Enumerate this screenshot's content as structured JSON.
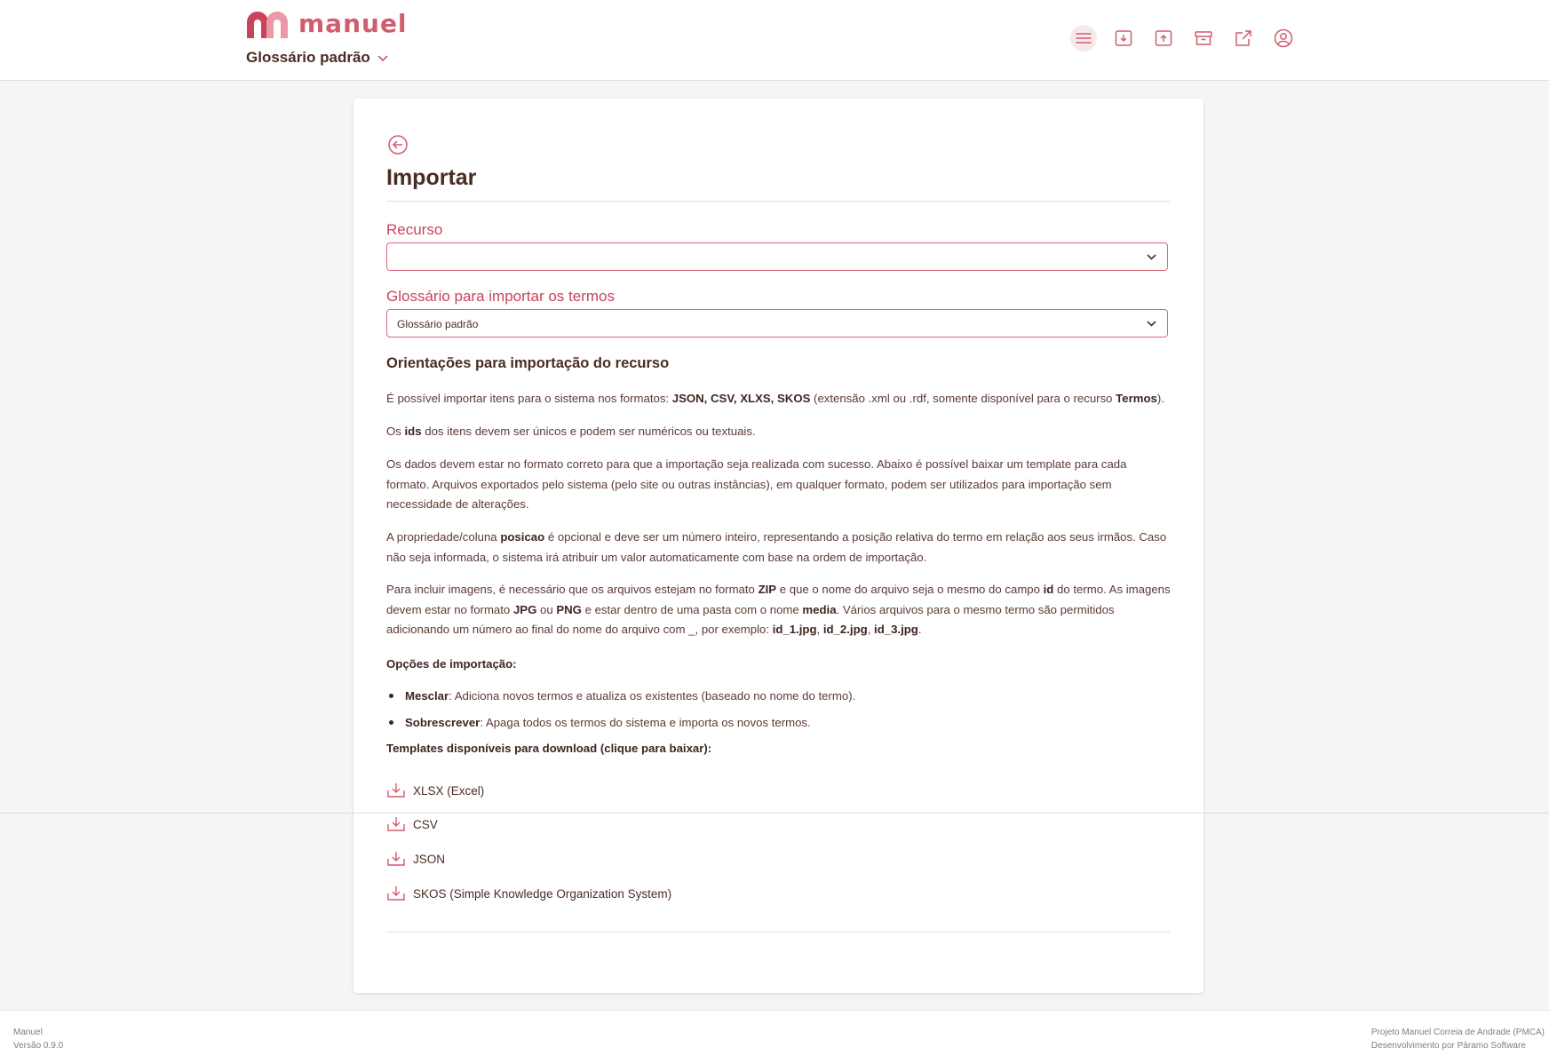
{
  "app": {
    "name": "manuel"
  },
  "header": {
    "glossary_selected": "Glossário padrão",
    "toolbar_icons": [
      "menu-icon",
      "download-icon",
      "upload-icon",
      "archive-icon",
      "external-link-icon",
      "user-icon"
    ]
  },
  "page": {
    "title": "Importar",
    "resource_label": "Recurso",
    "resource_value": "",
    "glossary_label": "Glossário para importar os termos",
    "glossary_value": "Glossário padrão"
  },
  "guidelines": {
    "title": "Orientações para importação do recurso",
    "p1": {
      "prefix": "É possível importar itens para o sistema nos formatos: ",
      "formats": "JSON, CSV, XLXS, SKOS",
      "middle": " (extensão .xml ou .rdf, somente disponível para o recurso ",
      "term": "Termos",
      "suffix": ")."
    },
    "p2": {
      "prefix": "Os ",
      "ids": "ids",
      "suffix": " dos itens devem ser únicos e podem ser numéricos ou textuais."
    },
    "p3": "Os dados devem estar no formato correto para que a importação seja realizada com sucesso. Abaixo é possível baixar um template para cada formato. Arquivos exportados pelo sistema (pelo site ou outras instâncias), em qualquer formato, podem ser utilizados para importação sem necessidade de alterações.",
    "p4": {
      "prefix": "A propriedade/coluna ",
      "field": "posicao",
      "suffix": " é opcional e deve ser um número inteiro, representando a posição relativa do termo em relação aos seus irmãos. Caso não seja informada, o sistema irá atribuir um valor automaticamente com base na ordem de importação."
    },
    "p5": {
      "t1": "Para incluir imagens, é necessário que os arquivos estejam no formato ",
      "zip": "ZIP",
      "t2": " e que o nome do arquivo seja o mesmo do campo ",
      "id": "id",
      "t3": " do termo. As imagens devem estar no formato ",
      "jpg": "JPG",
      "t4": " ou ",
      "png": "PNG",
      "t5": " e estar dentro de uma pasta com o nome ",
      "media": "media",
      "t6": ". Vários arquivos para o mesmo termo são permitidos adicionando um número ao final do nome do arquivo com _, por exemplo: ",
      "ex1": "id_1.jpg",
      "sep1": ", ",
      "ex2": "id_2.jpg",
      "sep2": ", ",
      "ex3": "id_3.jpg",
      "end": "."
    },
    "options_title": "Opções de importação:",
    "options": [
      {
        "name": "Mesclar",
        "desc": ": Adiciona novos termos e atualiza os existentes (baseado no nome do termo)."
      },
      {
        "name": "Sobrescrever",
        "desc": ": Apaga todos os termos do sistema e importa os novos termos."
      }
    ],
    "templates_title": "Templates disponíveis para download (clique para baixar):",
    "templates": [
      "XLSX (Excel)",
      "CSV",
      "JSON",
      "SKOS (Simple Knowledge Organization System)"
    ]
  },
  "footer": {
    "app_name": "Manuel",
    "version": "Versão 0.9.0",
    "project": "Projeto Manuel Correia de Andrade (PMCA)",
    "developer": "Desenvolvimento por Páramo Software"
  },
  "colors": {
    "accent": "#c9445a",
    "text": "#4a2c25",
    "background": "#f5f5f4"
  }
}
